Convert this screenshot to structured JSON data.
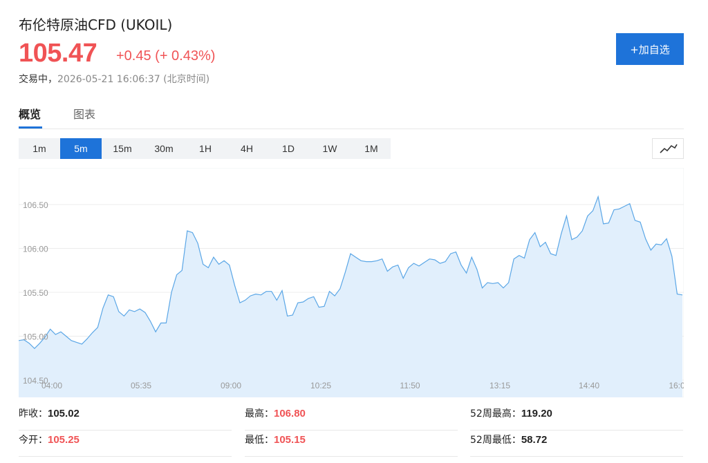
{
  "header": {
    "name": "布伦特原油CFD",
    "symbol": "(UKOIL)",
    "price": "105.47",
    "change": "+0.45 (+ 0.43%)",
    "status": "交易中，",
    "timestamp": "2026-05-21 16:06:37",
    "timezone": "(北京时间)",
    "add_button": "+加自选"
  },
  "tabs": [
    {
      "label": "概览",
      "active": true
    },
    {
      "label": "图表",
      "active": false
    }
  ],
  "intervals": [
    {
      "label": "1m"
    },
    {
      "label": "5m",
      "active": true
    },
    {
      "label": "15m"
    },
    {
      "label": "30m"
    },
    {
      "label": "1H"
    },
    {
      "label": "4H"
    },
    {
      "label": "1D"
    },
    {
      "label": "1W"
    },
    {
      "label": "1M"
    }
  ],
  "chart_type_icon": "line-chart-icon",
  "colors": {
    "accent": "#1e73d9",
    "up": "#f05355",
    "line": "#5aa6e6",
    "fill": "#e1effc"
  },
  "chart_data": {
    "type": "area",
    "x_labels": [
      "04:00",
      "05:35",
      "09:00",
      "10:25",
      "11:50",
      "13:15",
      "14:40",
      "16:0"
    ],
    "y_ticks": [
      "104.50",
      "105.00",
      "105.50",
      "106.00",
      "106.50"
    ],
    "ylim": [
      104.5,
      106.9
    ],
    "grid": true,
    "values": [
      104.95,
      104.96,
      104.92,
      104.86,
      104.92,
      104.99,
      105.08,
      105.02,
      105.05,
      105.0,
      104.95,
      104.93,
      104.91,
      104.97,
      105.04,
      105.1,
      105.32,
      105.47,
      105.45,
      105.28,
      105.23,
      105.3,
      105.28,
      105.31,
      105.27,
      105.17,
      105.05,
      105.15,
      105.15,
      105.5,
      105.7,
      105.75,
      106.2,
      106.18,
      106.06,
      105.82,
      105.78,
      105.9,
      105.82,
      105.86,
      105.81,
      105.58,
      105.38,
      105.41,
      105.46,
      105.48,
      105.47,
      105.51,
      105.51,
      105.41,
      105.52,
      105.23,
      105.24,
      105.38,
      105.39,
      105.43,
      105.45,
      105.33,
      105.34,
      105.51,
      105.46,
      105.54,
      105.73,
      105.94,
      105.9,
      105.86,
      105.85,
      105.85,
      105.86,
      105.88,
      105.74,
      105.79,
      105.81,
      105.66,
      105.78,
      105.83,
      105.8,
      105.84,
      105.88,
      105.87,
      105.83,
      105.85,
      105.94,
      105.96,
      105.81,
      105.72,
      105.9,
      105.76,
      105.55,
      105.61,
      105.6,
      105.61,
      105.55,
      105.61,
      105.88,
      105.92,
      105.89,
      106.1,
      106.18,
      106.02,
      106.07,
      105.94,
      105.92,
      106.17,
      106.37,
      106.1,
      106.13,
      106.2,
      106.37,
      106.43,
      106.59,
      106.28,
      106.29,
      106.44,
      106.45,
      106.48,
      106.51,
      106.32,
      106.3,
      106.11,
      105.98,
      106.05,
      106.04,
      106.11,
      105.91,
      105.48,
      105.47
    ]
  },
  "stats": [
    {
      "label": "昨收：",
      "value": "105.02",
      "red": false
    },
    {
      "label": "最高：",
      "value": "106.80",
      "red": true
    },
    {
      "label": "52周最高：",
      "value": "119.20",
      "red": false
    },
    {
      "label": "今开：",
      "value": "105.25",
      "red": true
    },
    {
      "label": "最低：",
      "value": "105.15",
      "red": true
    },
    {
      "label": "52周最低：",
      "value": "58.72",
      "red": false
    }
  ]
}
